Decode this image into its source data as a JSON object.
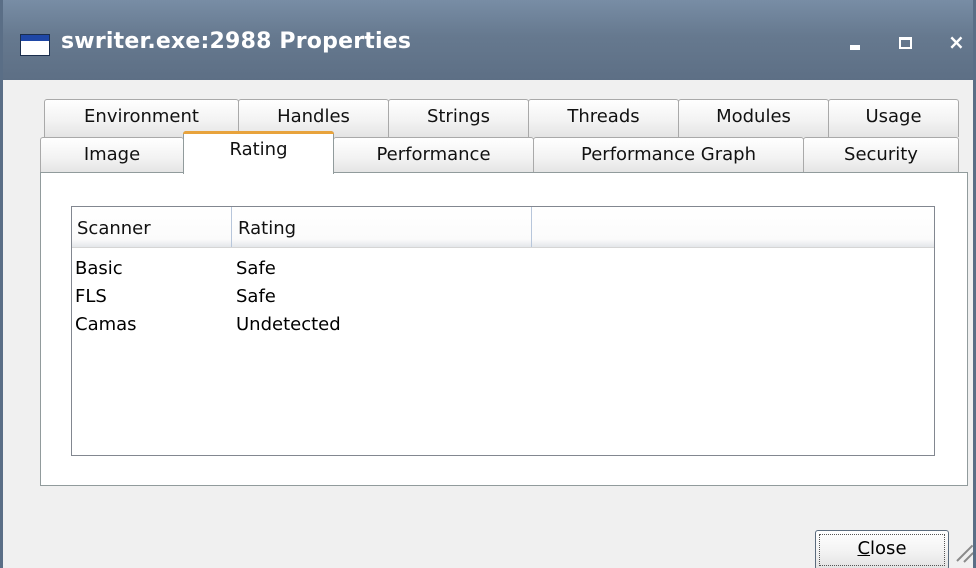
{
  "window": {
    "title": "swriter.exe:2988 Properties",
    "close_label": "Close"
  },
  "tabs": {
    "row1": [
      "Environment",
      "Handles",
      "Strings",
      "Threads",
      "Modules",
      "Usage"
    ],
    "row2": [
      "Image",
      "Rating",
      "Performance",
      "Performance Graph",
      "Security"
    ],
    "active": "Rating"
  },
  "rating_list": {
    "columns": [
      "Scanner",
      "Rating",
      ""
    ],
    "rows": [
      {
        "scanner": "Basic",
        "rating": "Safe"
      },
      {
        "scanner": "FLS",
        "rating": "Safe"
      },
      {
        "scanner": "Camas",
        "rating": "Undetected"
      }
    ]
  },
  "colors": {
    "titlebar": "#66798f",
    "active_tab_accent": "#e8a33c",
    "window_bg": "#f0f0f0"
  }
}
